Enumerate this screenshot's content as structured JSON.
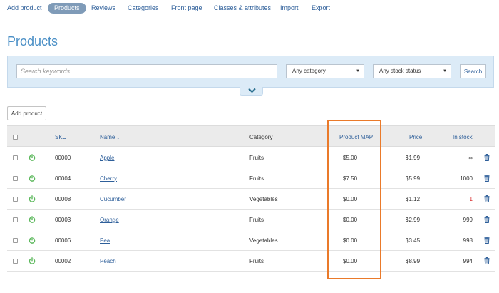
{
  "nav": {
    "items": [
      "Add product",
      "Products",
      "Reviews",
      "Categories",
      "Front page",
      "Classes & attributes",
      "Import",
      "Export"
    ],
    "active_index": 1
  },
  "page_title": "Products",
  "search": {
    "placeholder": "Search keywords",
    "category_select": "Any category",
    "stock_select": "Any stock status",
    "button": "Search"
  },
  "add_product_button": "Add product",
  "table": {
    "columns": {
      "sku": "SKU",
      "name": "Name ↓",
      "category": "Category",
      "product_map": "Product MAP",
      "price": "Price",
      "in_stock": "In stock"
    },
    "rows": [
      {
        "sku": "00000",
        "name": "Apple",
        "category": "Fruits",
        "map": "$5.00",
        "price": "$1.99",
        "stock": "∞",
        "low": false
      },
      {
        "sku": "00004",
        "name": "Cherry",
        "category": "Fruits",
        "map": "$7.50",
        "price": "$5.99",
        "stock": "1000",
        "low": false
      },
      {
        "sku": "00008",
        "name": "Cucumber",
        "category": "Vegetables",
        "map": "$0.00",
        "price": "$1.12",
        "stock": "1",
        "low": true
      },
      {
        "sku": "00003",
        "name": "Orange",
        "category": "Fruits",
        "map": "$0.00",
        "price": "$2.99",
        "stock": "999",
        "low": false
      },
      {
        "sku": "00006",
        "name": "Pea",
        "category": "Vegetables",
        "map": "$0.00",
        "price": "$3.45",
        "stock": "998",
        "low": false
      },
      {
        "sku": "00002",
        "name": "Peach",
        "category": "Fruits",
        "map": "$0.00",
        "price": "$8.99",
        "stock": "994",
        "low": false
      }
    ]
  },
  "colors": {
    "accent": "#4a8fc6",
    "link": "#2e5f9a",
    "active_nav": "#7f9bb8",
    "panel": "#dcebf7",
    "highlight": "#ea7a2a",
    "power_icon": "#5cb85c",
    "low_stock": "#d62020"
  }
}
